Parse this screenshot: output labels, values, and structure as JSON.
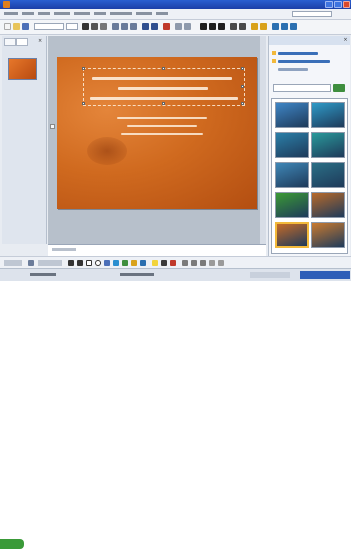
{
  "window": {
    "title": "",
    "brand_color": "#1c3fa8"
  },
  "menubar": {
    "items": []
  },
  "slides_pane": {
    "thumbnail_number": ""
  },
  "slide": {
    "accent_color": "#d06a1f"
  },
  "task_pane": {
    "title": "",
    "close_glyph": "×"
  },
  "gallery": {
    "tile_colors": [
      "#3f86c6",
      "#2f9bc8",
      "#2b7fa8",
      "#2a9a9b",
      "#3f87b7",
      "#2b6f86",
      "#3b9a34",
      "#b86a2a",
      "#c46a28",
      "#c97a2f"
    ],
    "selected_index": 8
  },
  "statusbar": {
    "left_text": "",
    "middle_text": ""
  }
}
